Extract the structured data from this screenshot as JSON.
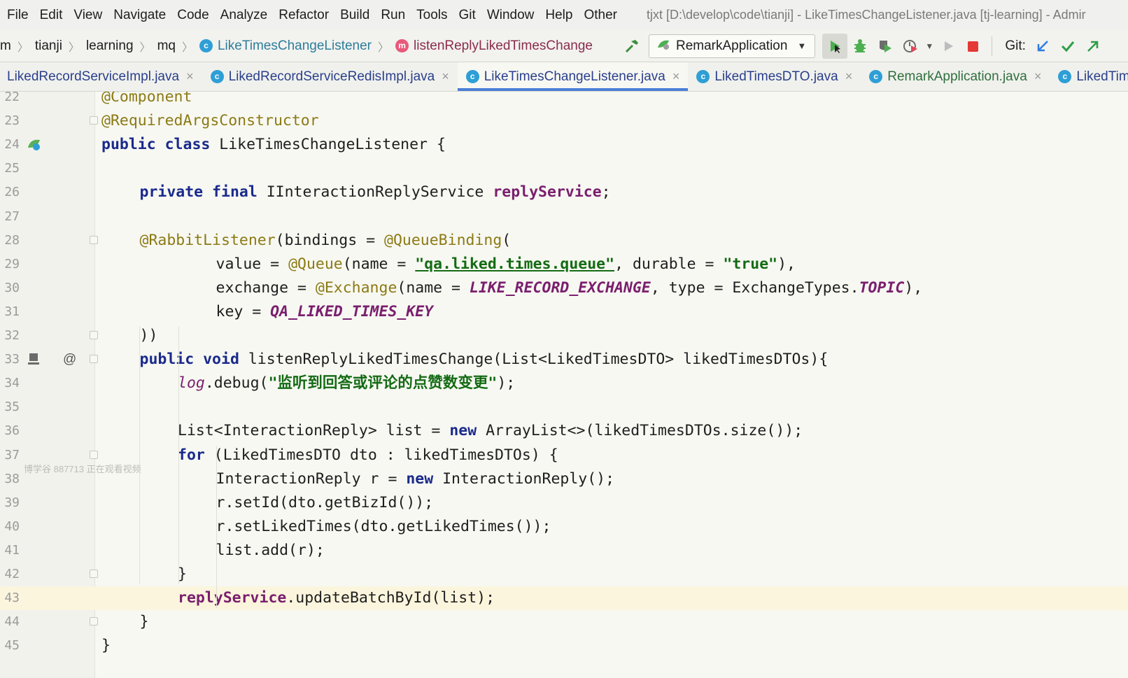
{
  "menu": {
    "items": [
      "File",
      "Edit",
      "View",
      "Navigate",
      "Code",
      "Analyze",
      "Refactor",
      "Build",
      "Run",
      "Tools",
      "Git",
      "Window",
      "Help",
      "Other"
    ],
    "window_title": "tjxt [D:\\develop\\code\\tianji] - LikeTimesChangeListener.java [tj-learning] - Admir"
  },
  "breadcrumb": {
    "items": [
      "m",
      "tianji",
      "learning",
      "mq"
    ],
    "class_name": "LikeTimesChangeListener",
    "method_name": "listenReplyLikedTimesChange"
  },
  "toolbar": {
    "run_config": "RemarkApplication",
    "git_label": "Git:",
    "colors": {
      "run": "#4caf50",
      "stop": "#e53935",
      "git_update": "#2f7de1",
      "git_commit": "#2e9d46"
    },
    "icons": [
      "build-hammer-icon",
      "run-config-icon",
      "run-icon",
      "debug-icon",
      "coverage-icon",
      "profile-icon",
      "run-disabled-icon",
      "stop-icon",
      "git-update-icon",
      "git-commit-icon",
      "git-push-icon"
    ]
  },
  "tabs": [
    {
      "label": "LikedRecordServiceImpl.java",
      "active": false
    },
    {
      "label": "LikedRecordServiceRedisImpl.java",
      "active": false
    },
    {
      "label": "LikeTimesChangeListener.java",
      "active": true
    },
    {
      "label": "LikedTimesDTO.java",
      "active": false
    },
    {
      "label": "RemarkApplication.java",
      "active": false
    },
    {
      "label": "LikedTim",
      "active": false
    }
  ],
  "editor": {
    "current_line": 43,
    "watermark": "博学谷 887713 正在观看视频",
    "lines": [
      {
        "n": "22",
        "indent": 0,
        "tokens": [
          [
            "ann",
            "@Component"
          ]
        ]
      },
      {
        "n": "23",
        "indent": 0,
        "tokens": [
          [
            "ann",
            "@RequiredArgsConstructor"
          ]
        ]
      },
      {
        "n": "24",
        "indent": 0,
        "tokens": [
          [
            "kw",
            "public class "
          ],
          [
            "",
            "LikeTimesChangeListener {"
          ]
        ]
      },
      {
        "n": "25",
        "indent": 0,
        "tokens": []
      },
      {
        "n": "26",
        "indent": 1,
        "tokens": [
          [
            "kw",
            "private final "
          ],
          [
            "",
            "IInteractionReplyService "
          ],
          [
            "field",
            "replyService"
          ],
          [
            "",
            ";"
          ]
        ]
      },
      {
        "n": "27",
        "indent": 0,
        "tokens": []
      },
      {
        "n": "28",
        "indent": 1,
        "tokens": [
          [
            "ann",
            "@RabbitListener"
          ],
          [
            "",
            "(bindings = "
          ],
          [
            "ann",
            "@QueueBinding"
          ],
          [
            "",
            "("
          ]
        ]
      },
      {
        "n": "29",
        "indent": 3,
        "tokens": [
          [
            "",
            "value = "
          ],
          [
            "ann",
            "@Queue"
          ],
          [
            "",
            "(name = "
          ],
          [
            "str",
            "\"qa.liked.times.queue\""
          ],
          [
            "",
            ", durable = "
          ],
          [
            "str",
            "\"true\""
          ],
          [
            "",
            "),"
          ]
        ]
      },
      {
        "n": "30",
        "indent": 3,
        "tokens": [
          [
            "",
            "exchange = "
          ],
          [
            "ann",
            "@Exchange"
          ],
          [
            "",
            "(name = "
          ],
          [
            "const",
            "LIKE_RECORD_EXCHANGE"
          ],
          [
            "",
            ", type = ExchangeTypes."
          ],
          [
            "const",
            "TOPIC"
          ],
          [
            "",
            "),"
          ]
        ]
      },
      {
        "n": "31",
        "indent": 3,
        "tokens": [
          [
            "",
            "key = "
          ],
          [
            "const",
            "QA_LIKED_TIMES_KEY"
          ]
        ]
      },
      {
        "n": "32",
        "indent": 1,
        "tokens": [
          [
            "",
            "))"
          ]
        ]
      },
      {
        "n": "33",
        "indent": 1,
        "tokens": [
          [
            "kw",
            "public void "
          ],
          [
            "",
            "listenReplyLikedTimesChange(List<LikedTimesDTO> likedTimesDTOs){"
          ]
        ]
      },
      {
        "n": "34",
        "indent": 2,
        "tokens": [
          [
            "logv",
            "log"
          ],
          [
            "",
            ".debug("
          ],
          [
            "str",
            "\"监听到回答或评论的点赞数变更\""
          ],
          [
            "",
            ");"
          ]
        ]
      },
      {
        "n": "35",
        "indent": 0,
        "tokens": []
      },
      {
        "n": "36",
        "indent": 2,
        "tokens": [
          [
            "",
            "List<InteractionReply> list = "
          ],
          [
            "kw",
            "new "
          ],
          [
            "",
            "ArrayList<>(likedTimesDTOs.size());"
          ]
        ]
      },
      {
        "n": "37",
        "indent": 2,
        "tokens": [
          [
            "kw",
            "for "
          ],
          [
            "",
            "(LikedTimesDTO dto : likedTimesDTOs) {"
          ]
        ]
      },
      {
        "n": "38",
        "indent": 3,
        "tokens": [
          [
            "",
            "InteractionReply r = "
          ],
          [
            "kw",
            "new "
          ],
          [
            "",
            "InteractionReply();"
          ]
        ]
      },
      {
        "n": "39",
        "indent": 3,
        "tokens": [
          [
            "",
            "r.setId(dto.getBizId());"
          ]
        ]
      },
      {
        "n": "40",
        "indent": 3,
        "tokens": [
          [
            "",
            "r.setLikedTimes(dto.getLikedTimes());"
          ]
        ]
      },
      {
        "n": "41",
        "indent": 3,
        "tokens": [
          [
            "",
            "list.add(r);"
          ]
        ]
      },
      {
        "n": "42",
        "indent": 2,
        "tokens": [
          [
            "",
            "}"
          ]
        ]
      },
      {
        "n": "43",
        "indent": 2,
        "tokens": [
          [
            "field",
            "replyService"
          ],
          [
            "",
            ".updateBatchById(list);"
          ]
        ]
      },
      {
        "n": "44",
        "indent": 1,
        "tokens": [
          [
            "",
            "}"
          ]
        ]
      },
      {
        "n": "45",
        "indent": 0,
        "tokens": [
          [
            "",
            "}"
          ]
        ]
      }
    ]
  }
}
